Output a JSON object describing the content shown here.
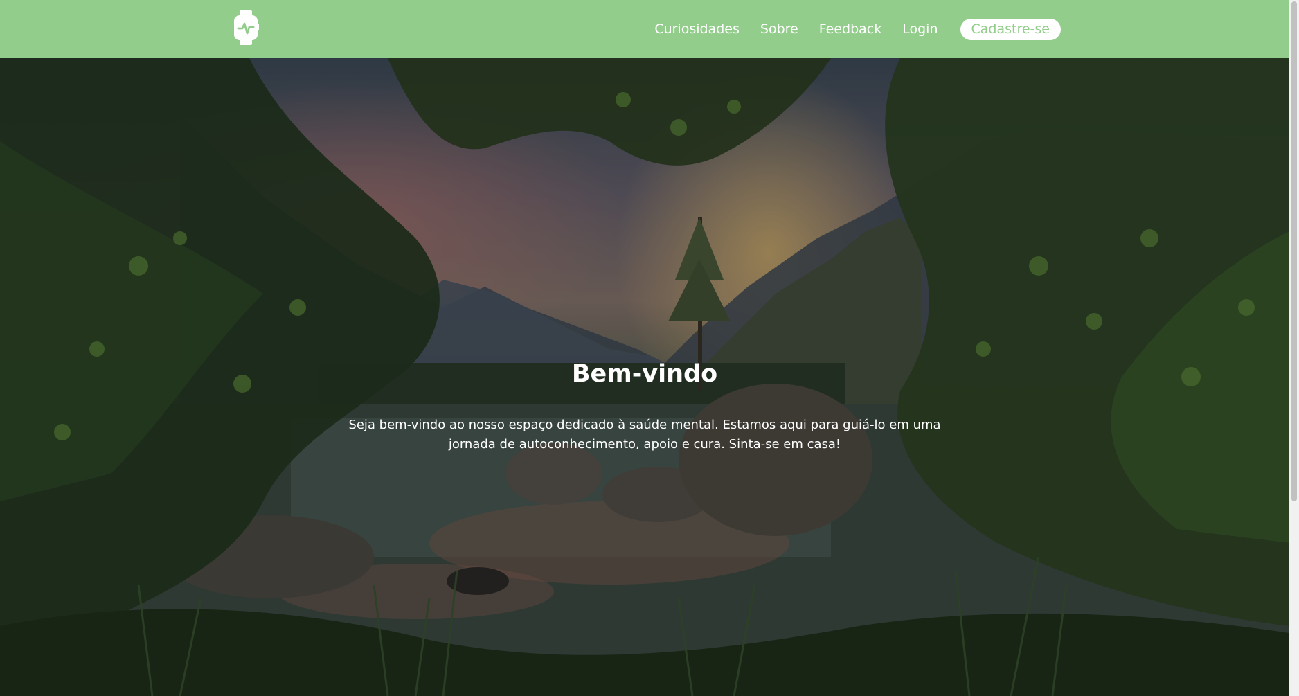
{
  "nav": {
    "logo_icon": "smartwatch-heartbeat-icon",
    "links": [
      {
        "label": "Curiosidades"
      },
      {
        "label": "Sobre"
      },
      {
        "label": "Feedback"
      },
      {
        "label": "Login"
      }
    ],
    "signup_label": "Cadastre-se"
  },
  "hero": {
    "title": "Bem-vindo",
    "text": "Seja bem-vindo ao nosso espaço dedicado à saúde mental. Estamos aqui para guiá-lo em uma jornada de autoconhecimento, apoio e cura. Sinta-se em casa!"
  },
  "colors": {
    "navbar": "#93cd8b",
    "signup_button_bg": "#ffffff",
    "signup_button_text": "#93cd8b"
  }
}
